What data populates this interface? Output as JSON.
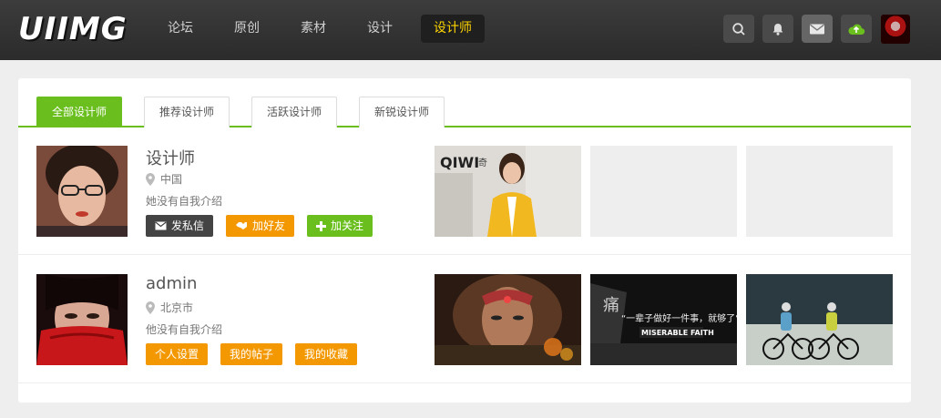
{
  "app": {
    "logo": "UIIMG"
  },
  "nav": {
    "items": [
      {
        "label": "论坛",
        "active": false
      },
      {
        "label": "原创",
        "active": false
      },
      {
        "label": "素材",
        "active": false
      },
      {
        "label": "设计",
        "active": false
      },
      {
        "label": "设计师",
        "active": true
      }
    ],
    "icons": [
      "search-icon",
      "bell-icon",
      "mail-icon",
      "cloud-upload-icon"
    ]
  },
  "colors": {
    "accent_green": "#6abf1e",
    "orange": "#f39800",
    "nav_active_text": "#ffd400",
    "dark_button": "#444444"
  },
  "tabs": [
    "全部设计师",
    "推荐设计师",
    "活跃设计师",
    "新锐设计师"
  ],
  "designers": [
    {
      "name": "设计师",
      "location": "中国",
      "bio": "她没有自我介绍",
      "buttons": [
        {
          "label": "发私信",
          "icon": "mail-icon"
        },
        {
          "label": "加好友",
          "icon": "handshake-icon"
        },
        {
          "label": "加关注",
          "icon": "plus-icon"
        }
      ],
      "works_shown": 1,
      "thumb_text": [
        "QIWI",
        "奇"
      ]
    },
    {
      "name": "admin",
      "location": "北京市",
      "bio": "他没有自我介绍",
      "buttons": [
        {
          "label": "个人设置"
        },
        {
          "label": "我的帖子"
        },
        {
          "label": "我的收藏"
        }
      ],
      "works_shown": 3,
      "thumb_text": [
        "“一辈子做好一件事，就够了”",
        "MISERABLE FAITH"
      ]
    }
  ]
}
